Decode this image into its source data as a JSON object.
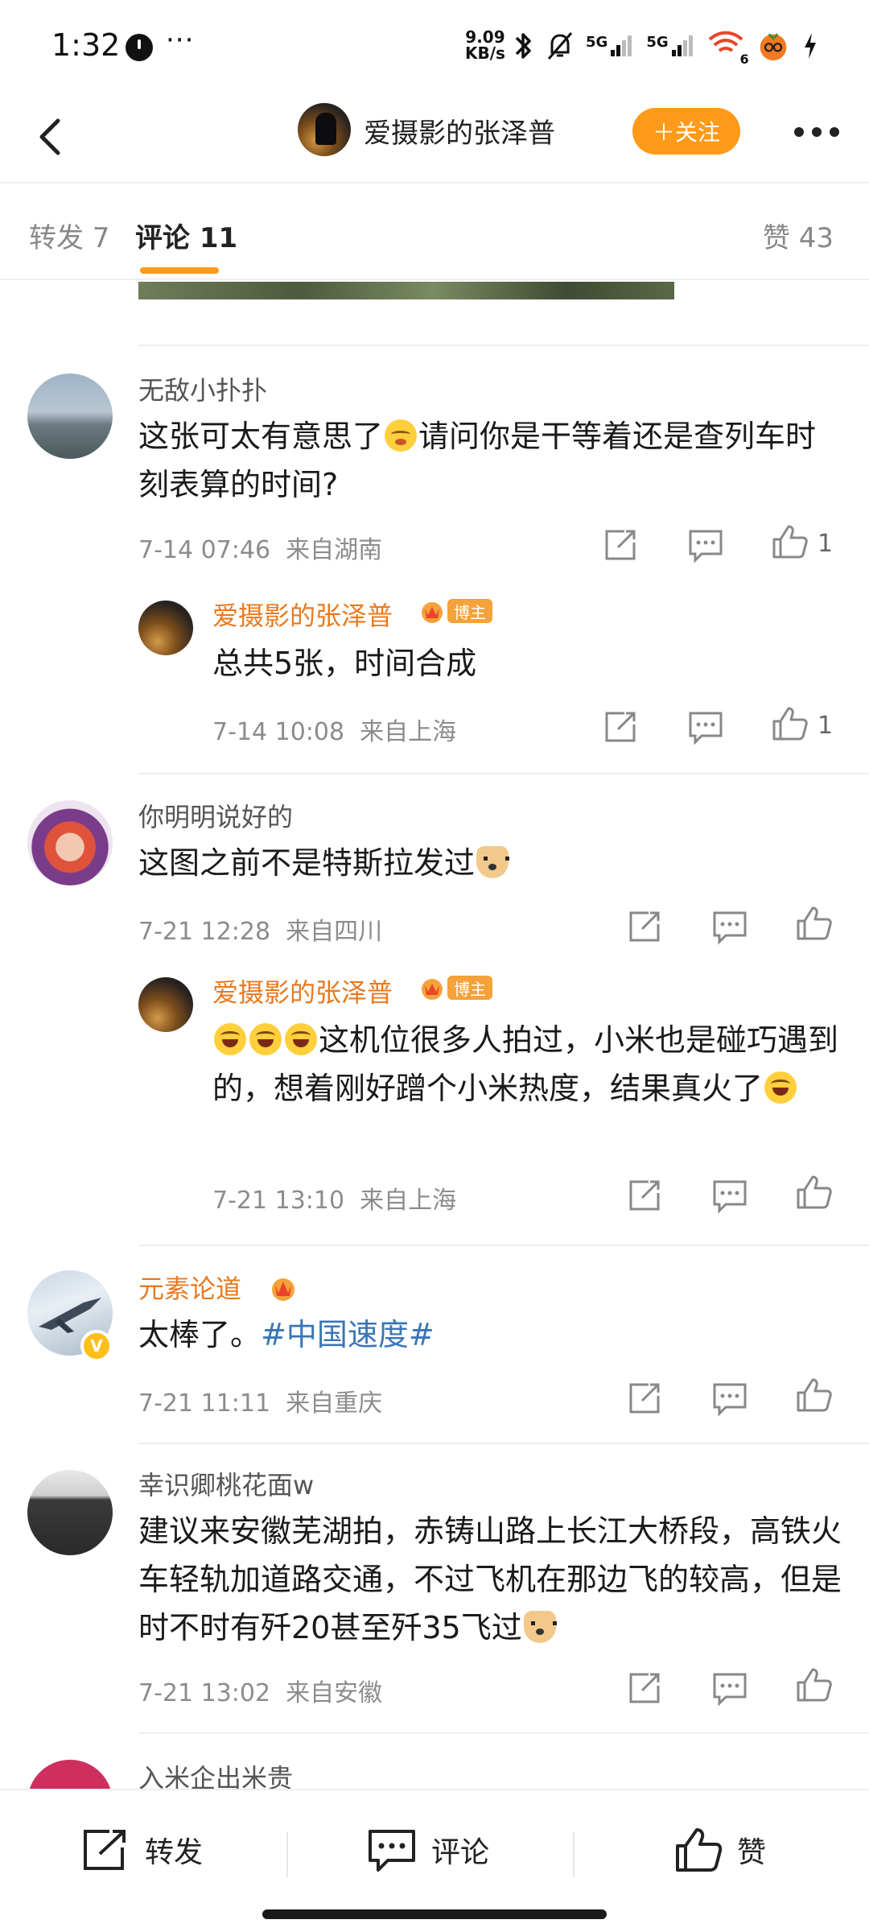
{
  "status_bar": {
    "time": "1:32",
    "more": "···",
    "net_speed_value": "9.09",
    "net_speed_unit": "KB/s",
    "net1": "5G",
    "net2": "5G",
    "wifi_badge": "6",
    "icons": [
      "clock-icon",
      "bluetooth-icon",
      "silent-bell-icon",
      "signal-icon",
      "signal-icon",
      "wifi-icon",
      "app-icon",
      "charging-icon"
    ]
  },
  "header": {
    "user_name": "爱摄影的张泽普",
    "follow_label": "＋关注"
  },
  "tabs": {
    "repost": "转发 7",
    "comment": "评论 11",
    "like": "赞 43"
  },
  "comments": [
    {
      "user": "无敌小扑扑",
      "text_a": "这张可太有意思了",
      "text_b": "请问你是干等着还是查列车时刻表算的时间?",
      "emoji": "blush-emoji",
      "time": "7-14 07:46",
      "location": "来自湖南",
      "likes": "1",
      "reply": {
        "user": "爱摄影的张泽普",
        "badge": "博主",
        "text": "总共5张，时间合成",
        "time": "7-14 10:08",
        "location": "来自上海",
        "likes": "1"
      }
    },
    {
      "user": "你明明说好的",
      "text_a": "这图之前不是特斯拉发过",
      "emoji": "doge-emoji",
      "time": "7-21 12:28",
      "location": "来自四川",
      "reply": {
        "user": "爱摄影的张泽普",
        "badge": "博主",
        "text_a": "这机位很多人拍过，小米也是碰巧遇到的，想着刚好蹭个小米热度，结果真火了",
        "emoji": "laugh-emoji",
        "time": "7-21 13:10",
        "location": "来自上海"
      }
    },
    {
      "user": "元素论道",
      "text_a": "太棒了。",
      "topic": "#中国速度#",
      "time": "7-21 11:11",
      "location": "来自重庆"
    },
    {
      "user": "幸识卿桃花面w",
      "text_a": "建议来安徽芜湖拍，赤铸山路上长江大桥段，高铁火车轻轨加道路交通，不过飞机在那边飞的较高，但是时不时有歼20甚至歼35飞过",
      "emoji": "doge-emoji",
      "time": "7-21 13:02",
      "location": "来自安徽"
    },
    {
      "user": "入米企出米贵"
    }
  ],
  "bottom_bar": {
    "repost": "转发",
    "comment": "评论",
    "like": "赞"
  },
  "colors": {
    "accent_orange": "#ff9a1a",
    "name_orange": "#e8791e",
    "topic_blue": "#3a76b5",
    "meta_gray": "#8c8c8c"
  }
}
